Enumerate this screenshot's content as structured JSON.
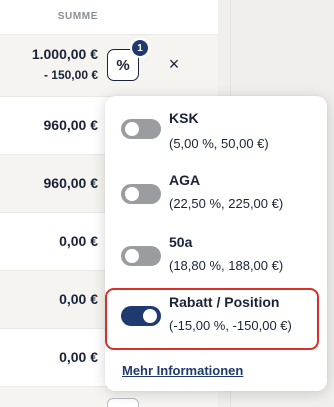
{
  "table": {
    "column_header": "SUMME",
    "rows": [
      {
        "amount": "1.000,00 €",
        "discount": "- 150,00 €"
      },
      {
        "amount": "960,00 €"
      },
      {
        "amount": "960,00 €"
      },
      {
        "amount": "0,00 €"
      },
      {
        "amount": "0,00 €"
      },
      {
        "amount": "0,00 €"
      }
    ],
    "percent_button_label": "%",
    "percent_badge_count": "1",
    "close_label": "×"
  },
  "popover": {
    "options": [
      {
        "name": "KSK",
        "detail": "(5,00 %, 50,00 €)",
        "enabled": false
      },
      {
        "name": "AGA",
        "detail": "(22,50 %, 225,00 €)",
        "enabled": false
      },
      {
        "name": "50a",
        "detail": "(18,80 %, 188,00 €)",
        "enabled": false
      },
      {
        "name": "Rabatt / Position",
        "detail": "(-15,00 %, -150,00 €)",
        "enabled": true
      }
    ],
    "more_info_label": "Mehr Informationen"
  },
  "colors": {
    "accent": "#1e3a6e",
    "highlight_frame": "#d9302a",
    "toggle_off": "#9a9ca0"
  }
}
